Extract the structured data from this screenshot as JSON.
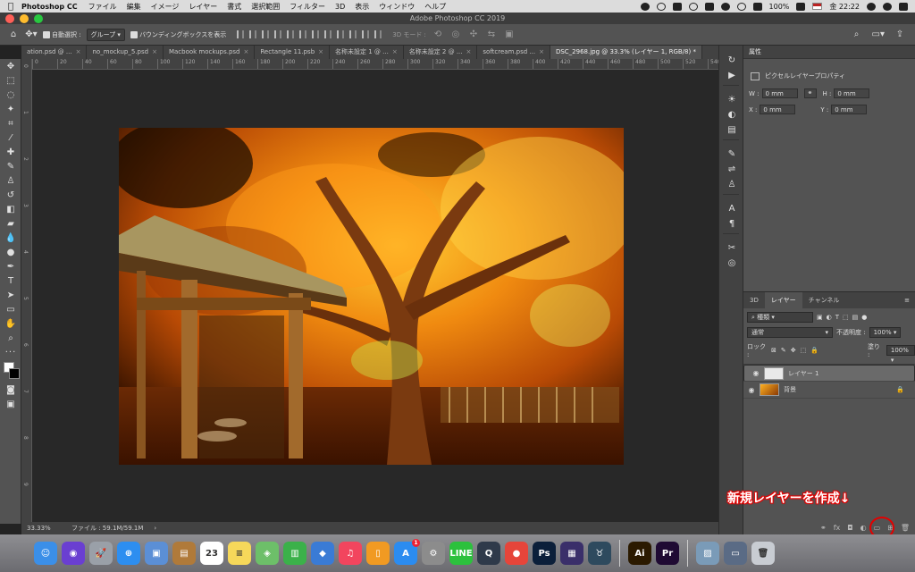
{
  "menubar": {
    "app_name": "Photoshop CC",
    "items": [
      "ファイル",
      "編集",
      "イメージ",
      "レイヤー",
      "書式",
      "選択範囲",
      "フィルター",
      "3D",
      "表示",
      "ウィンドウ",
      "ヘルプ"
    ],
    "battery": "100%",
    "clock": "金 22:22"
  },
  "window": {
    "title": "Adobe Photoshop CC 2019"
  },
  "options": {
    "auto_select_label": "自動選択 :",
    "group_select": "グループ",
    "bounding_box_label": "バウンディングボックスを表示",
    "mode_3d": "3D モード :"
  },
  "tabs": [
    {
      "label": "ation.psd @ ..."
    },
    {
      "label": "no_mockup_5.psd"
    },
    {
      "label": "Macbook mockups.psd"
    },
    {
      "label": "Rectangle 11.psb"
    },
    {
      "label": "名称未設定 1 @ ..."
    },
    {
      "label": "名称未設定 2 @ ..."
    },
    {
      "label": "softcream.psd ..."
    },
    {
      "label": "DSC_2968.jpg @ 33.3% (レイヤー 1, RGB/8) *"
    }
  ],
  "ruler_h": [
    "0",
    "20",
    "40",
    "60",
    "80",
    "100",
    "120",
    "140",
    "160",
    "180",
    "200",
    "220",
    "240",
    "260",
    "280",
    "300",
    "320",
    "340",
    "360",
    "380",
    "400",
    "420",
    "440",
    "460",
    "480",
    "500",
    "520",
    "540"
  ],
  "ruler_v": [
    "0",
    "1",
    "2",
    "3",
    "4",
    "5",
    "6",
    "7",
    "8",
    "9"
  ],
  "status": {
    "zoom": "33.33%",
    "file": "ファイル : 59.1M/59.1M"
  },
  "properties": {
    "title": "属性",
    "subtitle": "ピクセルレイヤープロパティ",
    "w_label": "W :",
    "w_value": "0 mm",
    "h_label": "H :",
    "h_value": "0 mm",
    "x_label": "X :",
    "x_value": "0 mm",
    "y_label": "Y :",
    "y_value": "0 mm"
  },
  "layers_panel": {
    "tabs": [
      "3D",
      "レイヤー",
      "チャンネル"
    ],
    "filter": "種類",
    "blend": "通常",
    "opacity_label": "不透明度 :",
    "opacity": "100%",
    "lock_label": "ロック :",
    "fill_label": "塗り :",
    "fill": "100%",
    "layers": [
      {
        "name": "レイヤー 1"
      },
      {
        "name": "背景"
      }
    ]
  },
  "callout": {
    "text": "新規レイヤーを作成↓"
  },
  "dock": [
    {
      "name": "finder-icon",
      "label": "☺",
      "color": "#3b8fe8"
    },
    {
      "name": "siri-icon",
      "label": "◉",
      "color": "#6a3fd1"
    },
    {
      "name": "launchpad-icon",
      "label": "🚀",
      "color": "#9aa0a8"
    },
    {
      "name": "safari-icon",
      "label": "⊕",
      "color": "#2d8ef0"
    },
    {
      "name": "preview-icon",
      "label": "▣",
      "color": "#5b8fd6"
    },
    {
      "name": "notebook-icon",
      "label": "▤",
      "color": "#b07a3a"
    },
    {
      "name": "calendar-icon",
      "label": "23",
      "color": "#ffffff"
    },
    {
      "name": "notes-icon",
      "label": "≡",
      "color": "#f6d85a"
    },
    {
      "name": "maps-icon",
      "label": "◈",
      "color": "#6dbf69"
    },
    {
      "name": "numbers-icon",
      "label": "▥",
      "color": "#3bb14a"
    },
    {
      "name": "keynote-icon",
      "label": "◆",
      "color": "#3a7bd5"
    },
    {
      "name": "music-icon",
      "label": "♫",
      "color": "#f2455e"
    },
    {
      "name": "books-icon",
      "label": "▯",
      "color": "#f19a22"
    },
    {
      "name": "appstore-icon",
      "label": "A",
      "color": "#2b8cf0",
      "badge": "1"
    },
    {
      "name": "settings-icon",
      "label": "⚙",
      "color": "#8c8c8c"
    },
    {
      "name": "line-icon",
      "label": "LINE",
      "color": "#2cc13d"
    },
    {
      "name": "quicktime-icon",
      "label": "Q",
      "color": "#2f3a4a"
    },
    {
      "name": "chrome-icon",
      "label": "●",
      "color": "#e6453a"
    },
    {
      "name": "photoshop-icon",
      "label": "Ps",
      "color": "#0b1f3a"
    },
    {
      "name": "imovie-icon",
      "label": "▦",
      "color": "#3a2f6a"
    },
    {
      "name": "bull-icon",
      "label": "♉",
      "color": "#2e4a5e"
    },
    {
      "name": "illustrator-icon",
      "label": "Ai",
      "color": "#2b1a00"
    },
    {
      "name": "premiere-icon",
      "label": "Pr",
      "color": "#1f0a33"
    },
    {
      "name": "photos-icon",
      "label": "▨",
      "color": "#7a9bb8"
    },
    {
      "name": "desktop-icon",
      "label": "▭",
      "color": "#5a6b85"
    },
    {
      "name": "trash-icon",
      "label": "🗑",
      "color": "#c8ccd2"
    }
  ],
  "colors": {
    "accent_red": "#e30000",
    "panel": "#535353",
    "canvas_bg": "#282828"
  }
}
